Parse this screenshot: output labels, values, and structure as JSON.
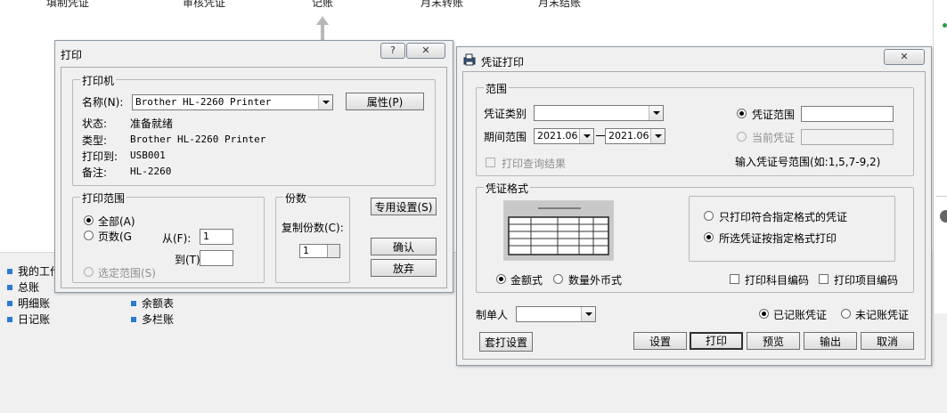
{
  "background": {
    "menu": [
      "填制凭证",
      "审核凭证",
      "记账",
      "月末转账",
      "月末结账"
    ],
    "list_left": [
      "我的工作",
      "总账",
      "明细账",
      "日记账"
    ],
    "list_right": [
      "余额表",
      "多栏账"
    ]
  },
  "print_dialog": {
    "title": "打印",
    "help_label": "?",
    "close_label": "✕",
    "printer_group": "打印机",
    "name_label": "名称(N):",
    "printer_name": "Brother HL-2260 Printer",
    "properties_button": "属性(P)",
    "status_label": "状态:",
    "status_value": "准备就绪",
    "type_label": "类型:",
    "type_value": "Brother HL-2260 Printer",
    "where_label": "打印到:",
    "where_value": "USB001",
    "comment_label": "备注:",
    "comment_value": "HL-2260",
    "range_group": "打印范围",
    "all_label": "全部(A)",
    "pages_label": "页数(G",
    "from_label": "从(F):",
    "from_value": "1",
    "to_label": "到(T):",
    "to_value": "",
    "selection_label": "选定范围(S)",
    "copies_group": "份数",
    "copies_label": "复制份数(C):",
    "copies_value": "1",
    "special_button": "专用设置(S)",
    "ok_button": "确认",
    "cancel_button": "放弃"
  },
  "voucher_dialog": {
    "title": "凭证打印",
    "close_label": "✕",
    "range_group": "范围",
    "category_label": "凭证类别",
    "category_value": "",
    "period_label": "期间范围",
    "period_from": "2021.06",
    "period_to": "2021.06",
    "print_query_label": "打印查询结果",
    "voucher_range_label": "凭证范围",
    "voucher_range_value": "",
    "current_voucher_label": "当前凭证",
    "current_voucher_value": "",
    "hint_text": "输入凭证号范围(如:1,5,7-9,2)",
    "format_group": "凭证格式",
    "only_matching_label": "只打印符合指定格式的凭证",
    "all_format_label": "所选凭证按指定格式打印",
    "amount_label": "金额式",
    "foreign_label": "数量外币式",
    "print_account_code_label": "打印科目编码",
    "print_item_code_label": "打印项目编码",
    "maker_label": "制单人",
    "maker_value": "",
    "posted_label": "已记账凭证",
    "unposted_label": "未记账凭证",
    "template_button": "套打设置",
    "setup_button": "设置",
    "print_button": "打印",
    "preview_button": "预览",
    "export_button": "输出",
    "cancel_button": "取消"
  }
}
